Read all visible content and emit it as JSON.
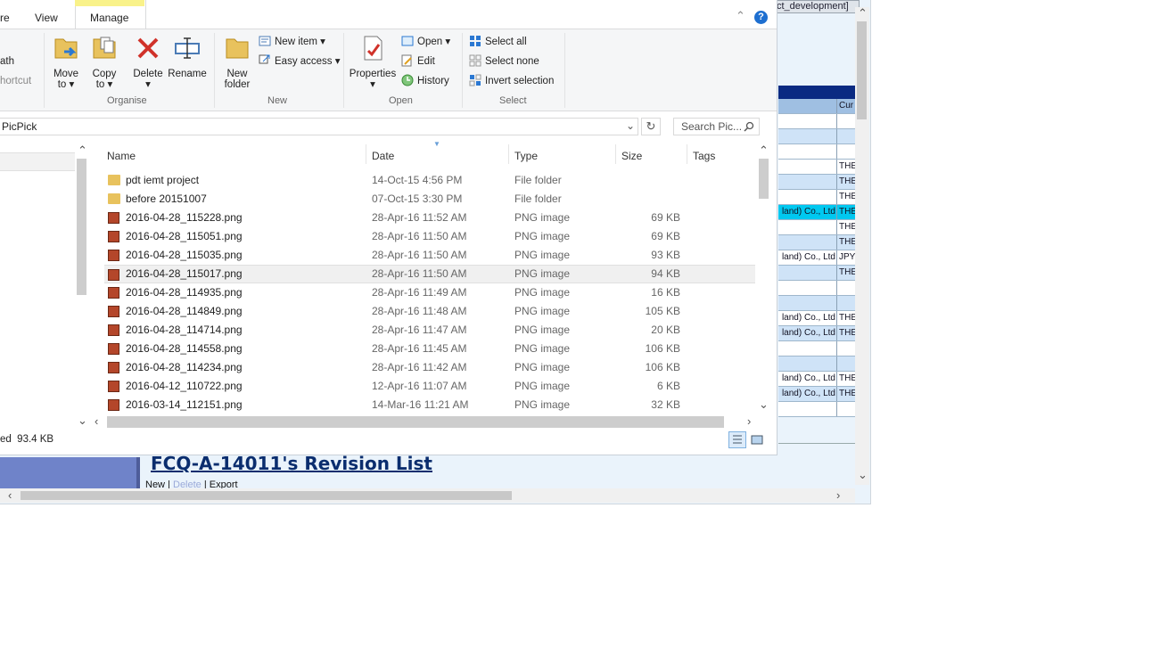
{
  "background_page": {
    "title_fragment": "ct_development]",
    "table_rows": [
      {
        "c1": "",
        "c2": "Cur",
        "style": "head"
      },
      {
        "c1": "",
        "c2": "",
        "style": "white"
      },
      {
        "c1": "",
        "c2": "",
        "style": "light"
      },
      {
        "c1": "",
        "c2": "",
        "style": "white"
      },
      {
        "c1": "",
        "c2": "THE",
        "style": "white"
      },
      {
        "c1": "",
        "c2": "THE",
        "style": "light"
      },
      {
        "c1": "",
        "c2": "THE",
        "style": "white"
      },
      {
        "c1": "land) Co., Ltd",
        "c2": "THE",
        "style": "cyan"
      },
      {
        "c1": "",
        "c2": "THE",
        "style": "white"
      },
      {
        "c1": "",
        "c2": "THE",
        "style": "light"
      },
      {
        "c1": "land) Co., Ltd",
        "c2": "JPY",
        "style": "white"
      },
      {
        "c1": "",
        "c2": "THE",
        "style": "light"
      },
      {
        "c1": "",
        "c2": "",
        "style": "white"
      },
      {
        "c1": "",
        "c2": "",
        "style": "light"
      },
      {
        "c1": "land) Co., Ltd",
        "c2": "THE",
        "style": "white"
      },
      {
        "c1": "land) Co., Ltd",
        "c2": "THE",
        "style": "light"
      },
      {
        "c1": "",
        "c2": "",
        "style": "white"
      },
      {
        "c1": "",
        "c2": "",
        "style": "light"
      },
      {
        "c1": "land) Co., Ltd",
        "c2": "THE",
        "style": "white"
      },
      {
        "c1": "land) Co., Ltd",
        "c2": "THE",
        "style": "light"
      },
      {
        "c1": "",
        "c2": "",
        "style": "white"
      }
    ],
    "revision_title": "FCQ-A-14011's Revision List",
    "links": {
      "new": "New",
      "delete": "Delete",
      "export": "Export",
      "sep": "|"
    }
  },
  "explorer": {
    "tabs": {
      "share": "re",
      "view": "View",
      "manage": "Manage"
    },
    "ribbon": {
      "left_items": {
        "path": "ath",
        "shortcut": "hortcut"
      },
      "organise": {
        "label": "Organise",
        "move_to": [
          "Move",
          "to"
        ],
        "copy_to": [
          "Copy",
          "to"
        ],
        "delete": "Delete",
        "rename": "Rename"
      },
      "new": {
        "label": "New",
        "new_folder": [
          "New",
          "folder"
        ],
        "new_item": "New item",
        "easy_access": "Easy access"
      },
      "open": {
        "label": "Open",
        "properties": "Properties",
        "open": "Open",
        "edit": "Edit",
        "history": "History"
      },
      "select": {
        "label": "Select",
        "select_all": "Select all",
        "select_none": "Select none",
        "invert": "Invert selection"
      }
    },
    "address": "PicPick",
    "search_placeholder": "Search Pic...",
    "columns": {
      "name": "Name",
      "date": "Date",
      "type": "Type",
      "size": "Size",
      "tags": "Tags"
    },
    "files": [
      {
        "name": "pdt iemt project",
        "date": "14-Oct-15 4:56 PM",
        "type": "File folder",
        "size": "",
        "kind": "folder"
      },
      {
        "name": "before 20151007",
        "date": "07-Oct-15 3:30 PM",
        "type": "File folder",
        "size": "",
        "kind": "folder"
      },
      {
        "name": "2016-04-28_115228.png",
        "date": "28-Apr-16 11:52 AM",
        "type": "PNG image",
        "size": "69 KB",
        "kind": "png"
      },
      {
        "name": "2016-04-28_115051.png",
        "date": "28-Apr-16 11:50 AM",
        "type": "PNG image",
        "size": "69 KB",
        "kind": "png"
      },
      {
        "name": "2016-04-28_115035.png",
        "date": "28-Apr-16 11:50 AM",
        "type": "PNG image",
        "size": "93 KB",
        "kind": "png"
      },
      {
        "name": "2016-04-28_115017.png",
        "date": "28-Apr-16 11:50 AM",
        "type": "PNG image",
        "size": "94 KB",
        "kind": "png",
        "selected": true
      },
      {
        "name": "2016-04-28_114935.png",
        "date": "28-Apr-16 11:49 AM",
        "type": "PNG image",
        "size": "16 KB",
        "kind": "png"
      },
      {
        "name": "2016-04-28_114849.png",
        "date": "28-Apr-16 11:48 AM",
        "type": "PNG image",
        "size": "105 KB",
        "kind": "png"
      },
      {
        "name": "2016-04-28_114714.png",
        "date": "28-Apr-16 11:47 AM",
        "type": "PNG image",
        "size": "20 KB",
        "kind": "png"
      },
      {
        "name": "2016-04-28_114558.png",
        "date": "28-Apr-16 11:45 AM",
        "type": "PNG image",
        "size": "106 KB",
        "kind": "png"
      },
      {
        "name": "2016-04-28_114234.png",
        "date": "28-Apr-16 11:42 AM",
        "type": "PNG image",
        "size": "106 KB",
        "kind": "png"
      },
      {
        "name": "2016-04-12_110722.png",
        "date": "12-Apr-16 11:07 AM",
        "type": "PNG image",
        "size": "6 KB",
        "kind": "png"
      },
      {
        "name": "2016-03-14_112151.png",
        "date": "14-Mar-16 11:21 AM",
        "type": "PNG image",
        "size": "32 KB",
        "kind": "png"
      }
    ],
    "status": "ed  93.4 KB",
    "help": "?",
    "colors": {
      "manage_highlight": "#f9f28a",
      "bg_header": "#0a2a82",
      "bg_cyan_row": "#00c8f0"
    }
  }
}
